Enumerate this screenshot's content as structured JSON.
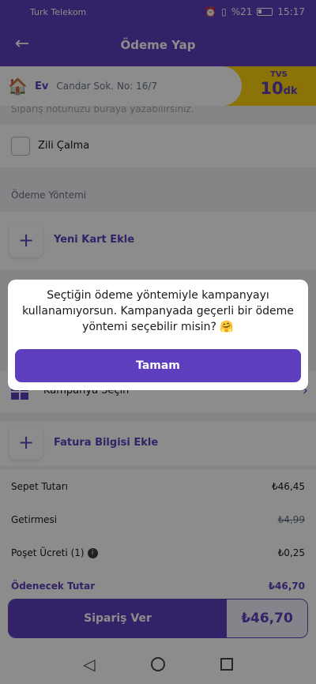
{
  "status_bar": {
    "carrier": "Turk Telekom",
    "battery": "%21",
    "time": "15:17"
  },
  "header": {
    "title": "Ödeme Yap"
  },
  "address": {
    "label": "Ev",
    "text": "Candar Sok. No: 16/7",
    "eta_label": "TVS",
    "eta_value": "10",
    "eta_unit": "dk"
  },
  "note_hint": "Sipariş notunuzu buraya yazabilirsiniz.",
  "doorbell": {
    "label": "Zili Çalma"
  },
  "payment": {
    "section_title": "Ödeme Yöntemi",
    "add_card_label": "Yeni Kart Ekle"
  },
  "campaign": {
    "label": "Kampanya Seçin"
  },
  "invoice": {
    "add_label": "Fatura Bilgisi Ekle"
  },
  "summary": {
    "rows": [
      {
        "label": "Sepet Tutarı",
        "value": "₺46,45"
      },
      {
        "label": "Getirmesi",
        "value": "₺4,99"
      },
      {
        "label": "Poşet Ücreti (1)",
        "value": "₺0,25"
      },
      {
        "label": "Ödenecek Tutar",
        "value": "₺46,70"
      }
    ]
  },
  "order": {
    "button_label": "Sipariş Ver",
    "total": "₺46,70"
  },
  "dialog": {
    "message": "Seçtiğin ödeme yöntemiyle kampanyayı kullanamıyorsun. Kampanyada geçerli bir ödeme yöntemi seçebilir misin? 🤗",
    "ok_label": "Tamam"
  },
  "colors": {
    "brand_purple": "#5d3ebc",
    "brand_yellow": "#ffd10d"
  }
}
